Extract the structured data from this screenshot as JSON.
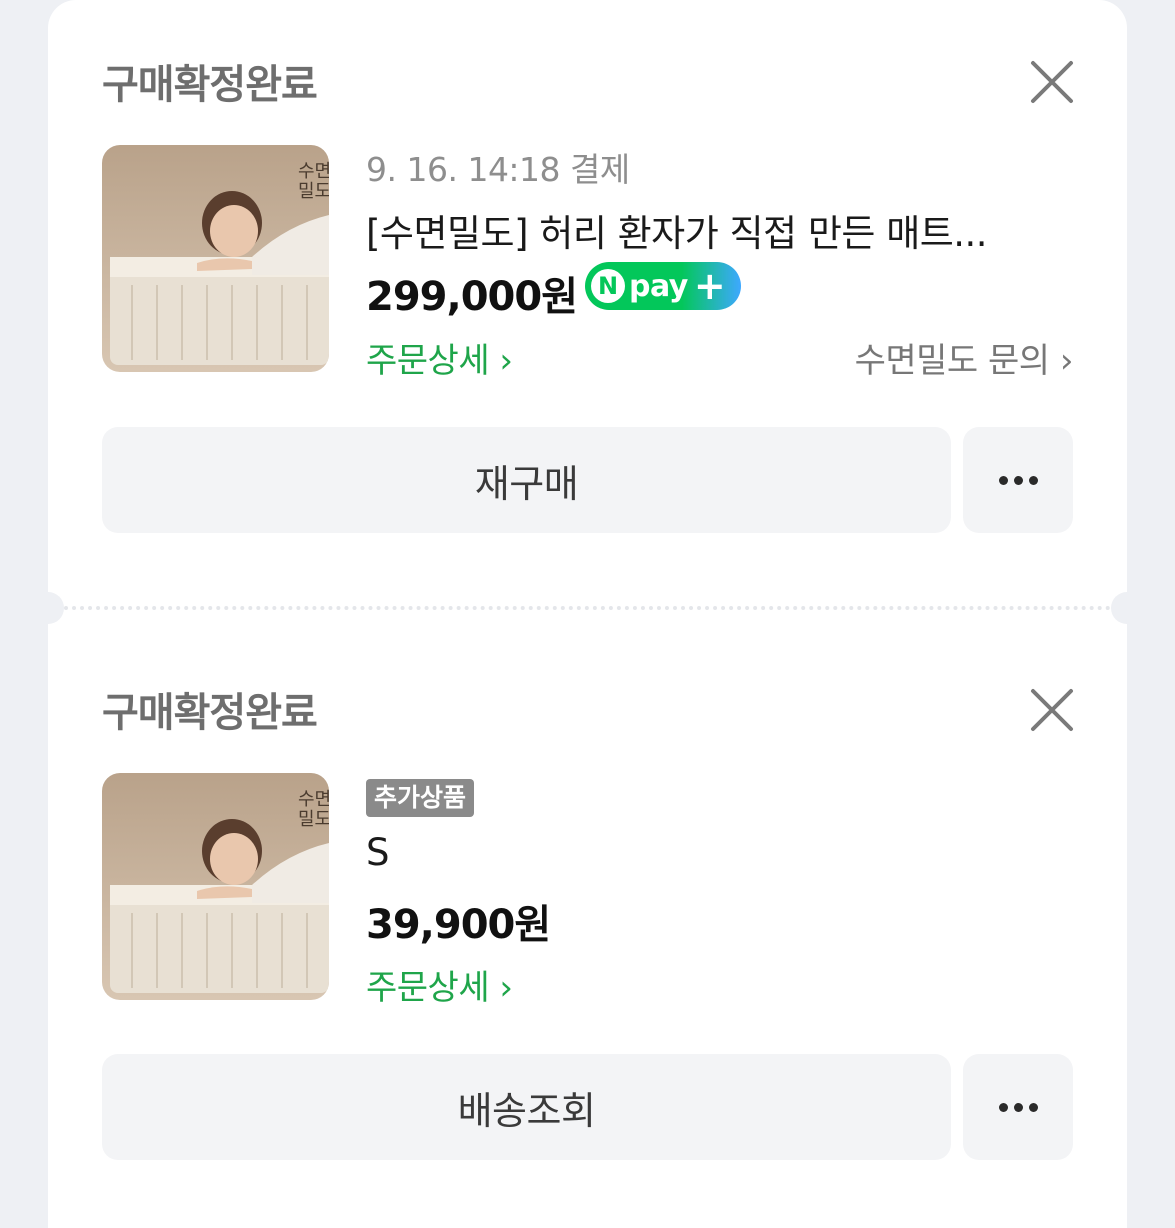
{
  "orders": [
    {
      "status": "구매확정완료",
      "payment_meta": "9. 16. 14:18 결제",
      "product_name": "[수면밀도] 허리 환자가 직접 만든 매트...",
      "price": "299,000원",
      "payment_badge": {
        "n": "N",
        "text": "pay",
        "plus": "+"
      },
      "detail_link": "주문상세",
      "inquiry_link": "수면밀도 문의",
      "action_button": "재구매",
      "thumbnail_text": "수면\n밀도"
    },
    {
      "status": "구매확정완료",
      "tag": "추가상품",
      "product_name": "S",
      "price": "39,900원",
      "detail_link": "주문상세",
      "action_button": "배송조회",
      "thumbnail_text": "수면\n밀도"
    }
  ],
  "colors": {
    "accent_green": "#1fa54a",
    "npay_green": "#03c75a",
    "npay_blue": "#3ea8ff"
  },
  "icons": {
    "close": "close-icon",
    "more": "more-icon",
    "chevron": "chevron-right-icon"
  }
}
